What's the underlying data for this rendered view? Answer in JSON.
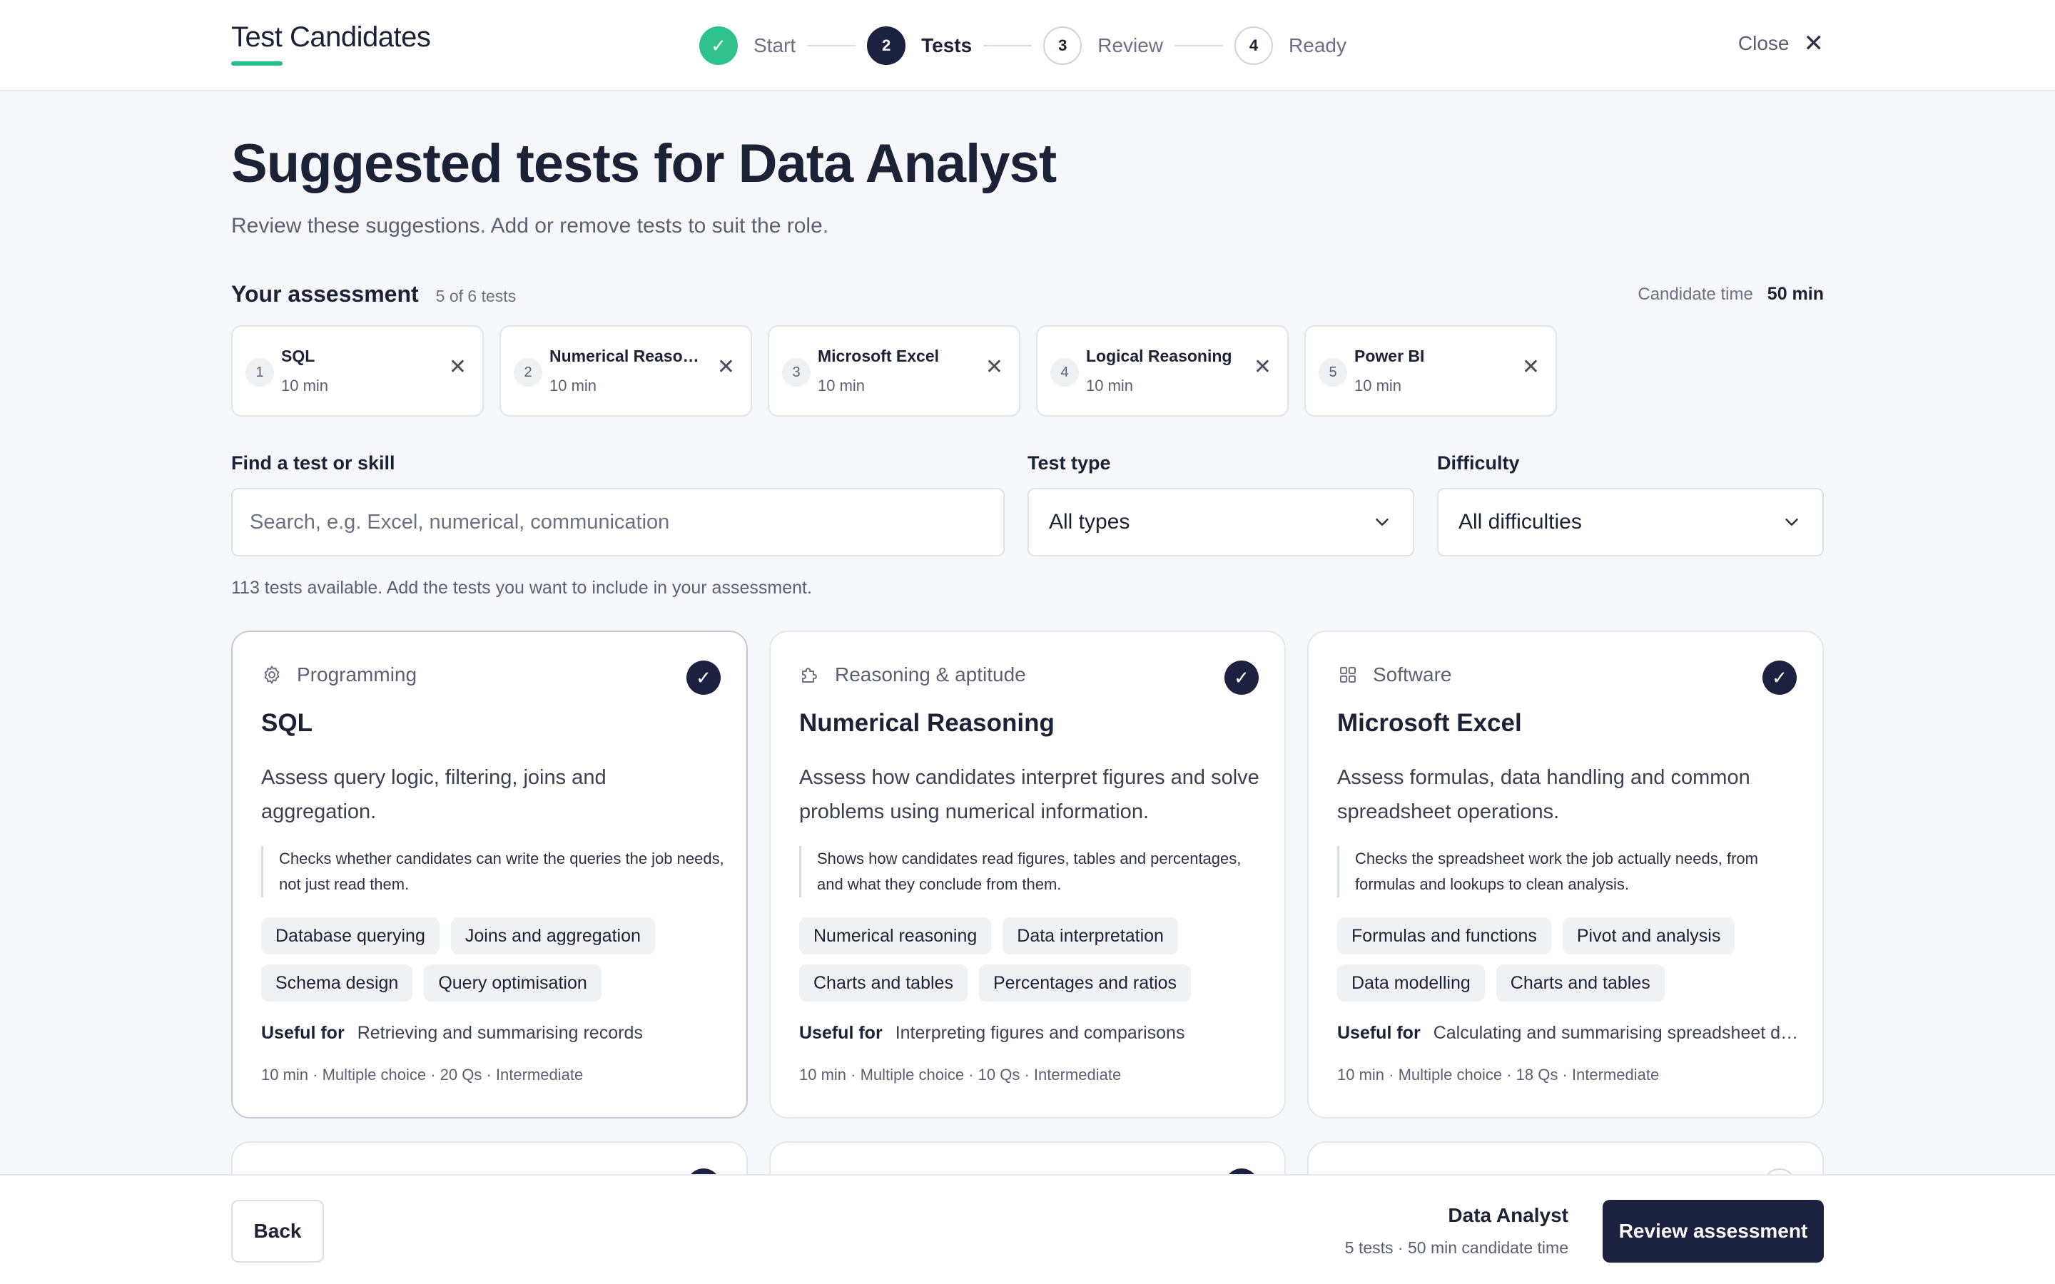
{
  "header": {
    "brand": "Test Candidates",
    "steps": [
      {
        "number": "1",
        "label": "Start",
        "state": "done",
        "icon": "check-icon"
      },
      {
        "number": "2",
        "label": "Tests",
        "state": "active"
      },
      {
        "number": "3",
        "label": "Review",
        "state": "upcoming"
      },
      {
        "number": "4",
        "label": "Ready",
        "state": "upcoming"
      }
    ],
    "close_label": "Close",
    "close_glyph": "✕",
    "check_glyph": "✓"
  },
  "main": {
    "title": "Suggested tests for Data Analyst",
    "subtitle": "Review these suggestions. Add or remove tests to suit the role."
  },
  "assessment": {
    "title": "Your assessment",
    "count": "5 of 6 tests",
    "candidate_time_label": "Candidate time",
    "candidate_time_value": "50 min",
    "items": [
      {
        "num": "1",
        "name": "SQL",
        "time": "10 min"
      },
      {
        "num": "2",
        "name": "Numerical Reasoning",
        "time": "10 min"
      },
      {
        "num": "3",
        "name": "Microsoft Excel",
        "time": "10 min"
      },
      {
        "num": "4",
        "name": "Logical Reasoning",
        "time": "10 min"
      },
      {
        "num": "5",
        "name": "Power BI",
        "time": "10 min"
      }
    ]
  },
  "filters": {
    "search_label": "Find a test or skill",
    "search_placeholder": "Search, e.g. Excel, numerical, communication",
    "search_value": "",
    "type_label": "Test type",
    "type_value": "All types",
    "difficulty_label": "Difficulty",
    "difficulty_value": "All difficulties",
    "available_note": "113 tests available. Add the tests you want to include in your assessment."
  },
  "cards": [
    {
      "category": "Programming",
      "category_icon": "gear-icon",
      "selected": true,
      "title": "SQL",
      "description": "Assess query logic, filtering, joins and aggregation.",
      "quote": "Checks whether candidates can write the queries the job needs, not just read them.",
      "tags": [
        "Database querying",
        "Joins and aggregation",
        "Schema design",
        "Query optimisation"
      ],
      "useful_label": "Useful for",
      "useful_value": "Retrieving and summarising records",
      "meta": "10 min · Multiple choice · 20 Qs · Intermediate"
    },
    {
      "category": "Reasoning & aptitude",
      "category_icon": "puzzle-icon",
      "selected": true,
      "title": "Numerical Reasoning",
      "description": "Assess how candidates interpret figures and solve problems using numerical information.",
      "quote": "Shows how candidates read figures, tables and percentages, and what they conclude from them.",
      "tags": [
        "Numerical reasoning",
        "Data interpretation",
        "Charts and tables",
        "Percentages and ratios"
      ],
      "useful_label": "Useful for",
      "useful_value": "Interpreting figures and comparisons",
      "meta": "10 min · Multiple choice · 10 Qs · Intermediate"
    },
    {
      "category": "Software",
      "category_icon": "grid-icon",
      "selected": true,
      "title": "Microsoft Excel",
      "description": "Assess formulas, data handling and common spreadsheet operations.",
      "quote": "Checks the spreadsheet work the job actually needs, from formulas and lookups to clean analysis.",
      "tags": [
        "Formulas and functions",
        "Pivot and analysis",
        "Data modelling",
        "Charts and tables"
      ],
      "useful_label": "Useful for",
      "useful_value": "Calculating and summarising spreadsheet data",
      "meta": "10 min · Multiple choice · 18 Qs · Intermediate"
    }
  ],
  "footer": {
    "back_label": "Back",
    "role": "Data Analyst",
    "summary": "5 tests · 50 min candidate time",
    "review_label": "Review assessment"
  },
  "colors": {
    "accent": "#1c2140",
    "success": "#2fc28d",
    "background": "#f6f7fa"
  }
}
